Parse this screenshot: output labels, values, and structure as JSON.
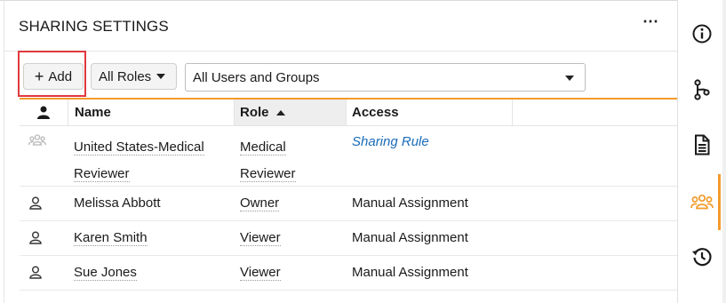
{
  "header": {
    "title": "SHARING SETTINGS",
    "more_label": "⋯"
  },
  "toolbar": {
    "add_label": "Add",
    "add_plus": "+",
    "roles_label": "All Roles",
    "filter_value": "All Users and Groups"
  },
  "table": {
    "columns": {
      "name": "Name",
      "role": "Role",
      "access": "Access"
    },
    "rows": [
      {
        "name_line1": "United States-Medical",
        "name_line2": "Reviewer",
        "role_line1": "Medical",
        "role_line2": "Reviewer",
        "access": "Sharing Rule",
        "icon": "group-icon"
      },
      {
        "name": "Melissa Abbott",
        "role": "Owner",
        "access": "Manual Assignment",
        "icon": "user-icon"
      },
      {
        "name": "Karen Smith",
        "role": "Viewer",
        "access": "Manual Assignment",
        "icon": "user-icon"
      },
      {
        "name": "Sue Jones",
        "role": "Viewer",
        "access": "Manual Assignment",
        "icon": "user-icon"
      }
    ]
  },
  "sidebar": {
    "items": [
      {
        "icon": "info-icon"
      },
      {
        "icon": "branch-icon"
      },
      {
        "icon": "document-icon"
      },
      {
        "icon": "users-icon",
        "active": true
      },
      {
        "icon": "history-icon"
      }
    ]
  },
  "colors": {
    "accent": "#f39a2b",
    "highlight": "#e0393e",
    "link": "#1a6bb8"
  }
}
